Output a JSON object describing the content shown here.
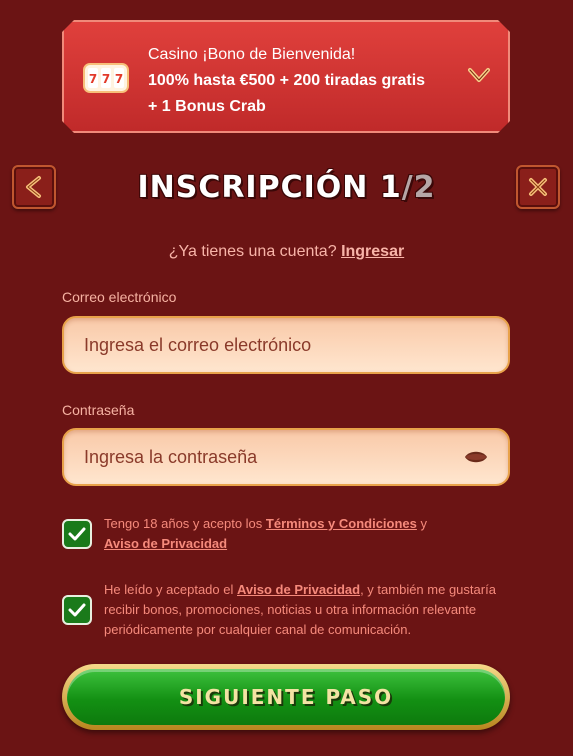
{
  "bonus": {
    "line1": "Casino ¡Bono de Bienvenida!",
    "line2": "100% hasta €500 + 200 tiradas gratis",
    "line3": "+ 1 Bonus Crab",
    "icon": "slot-reels-icon",
    "chevron_icon": "chevron-down-icon"
  },
  "nav": {
    "back_icon": "chevron-left-icon",
    "close_icon": "close-icon"
  },
  "title": {
    "text": "INSCRIPCIÓN",
    "step": "1",
    "separator": "/",
    "total": "2"
  },
  "login_prompt": {
    "text": "¿Ya tienes una cuenta?",
    "link": "Ingresar"
  },
  "email": {
    "label": "Correo electrónico",
    "placeholder": "Ingresa el correo electrónico"
  },
  "password": {
    "label": "Contraseña",
    "placeholder": "Ingresa la contraseña",
    "toggle_icon": "eye-icon"
  },
  "consent_age": {
    "checked": true,
    "text1": "Tengo 18 años y acepto los",
    "link1": "Términos y Condiciones",
    "text2": "y",
    "link2": "Aviso de Privacidad"
  },
  "consent_marketing": {
    "checked": true,
    "text1": "He leído y aceptado el",
    "link1": "Aviso de Privacidad",
    "text2": ", y también me gustaría recibir bonos, promociones, noticias u otra información relevante periódicamente por cualquier canal de comunicación."
  },
  "next_button": {
    "label": "SIGUIENTE PASO"
  },
  "colors": {
    "background": "#6b1414",
    "banner": "#d03330",
    "accent_text": "#f68a7c",
    "button_green": "#139013",
    "button_gold": "#d9ad4a"
  }
}
